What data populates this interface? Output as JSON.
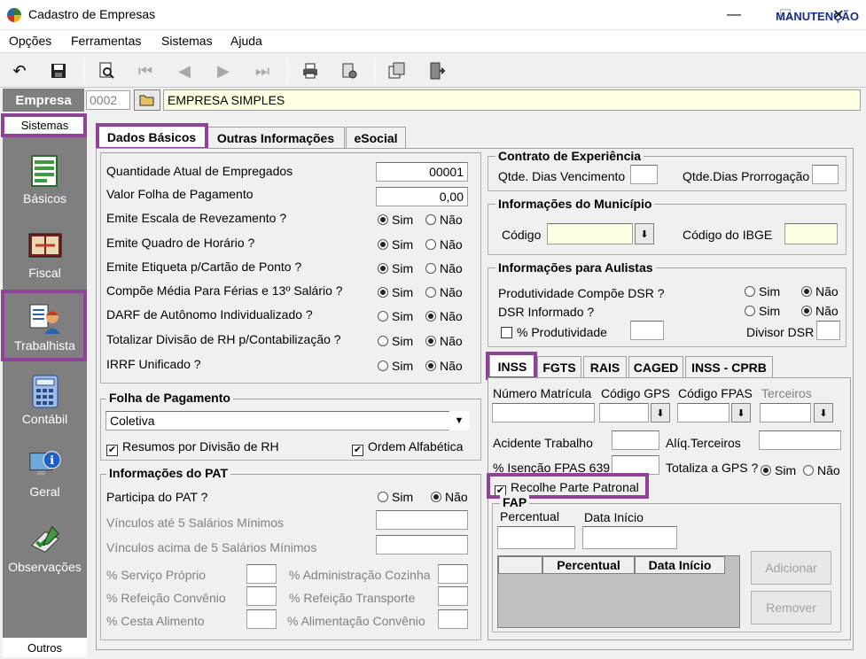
{
  "window": {
    "title": "Cadastro de Empresas",
    "minimize": "—",
    "maximize": "☐",
    "close": "✕"
  },
  "menu": [
    "Opções",
    "Ferramentas",
    "Sistemas",
    "Ajuda"
  ],
  "toolbar": {
    "mode_label": "MANUTENÇÃO"
  },
  "empresa": {
    "label": "Empresa",
    "code": "0002",
    "name": "EMPRESA SIMPLES"
  },
  "sidebar": {
    "header": "Sistemas",
    "footer": "Outros",
    "items": [
      "Básicos",
      "Fiscal",
      "Trabalhista",
      "Contábil",
      "Geral",
      "Observações"
    ]
  },
  "tabs": [
    "Dados Básicos",
    "Outras Informações",
    "eSocial"
  ],
  "dados": {
    "qtd_empregados_label": "Quantidade Atual de Empregados",
    "qtd_empregados": "00001",
    "valor_folha_label": "Valor Folha de Pagamento",
    "valor_folha": "0,00",
    "sim": "Sim",
    "nao": "Não",
    "questions": [
      "Emite Escala de Revezamento ?",
      "Emite Quadro de Horário ?",
      "Emite Etiqueta p/Cartão de Ponto ?",
      "Compõe Média Para Férias e 13º Salário ?",
      "DARF de Autônomo Individualizado ?",
      "Totalizar Divisão de RH p/Contabilização ?",
      "IRRF Unificado ?"
    ]
  },
  "folha": {
    "title": "Folha de Pagamento",
    "tipo": "Coletiva",
    "resumos": "Resumos por Divisão de RH",
    "ordem": "Ordem Alfabética"
  },
  "pat": {
    "title": "Informações do PAT",
    "participa": "Participa do PAT ?",
    "vinc5": "Vínculos até 5 Salários Mínimos",
    "vinc5plus": "Vínculos acima de 5 Salários Mínimos",
    "servico": "% Serviço Próprio",
    "admin": "% Administração Cozinha",
    "refconv": "% Refeição Convênio",
    "reftransp": "% Refeição Transporte",
    "cesta": "% Cesta Alimento",
    "alimconv": "% Alimentação Convênio"
  },
  "contrato": {
    "title": "Contrato de Experiência",
    "venc": "Qtde. Dias Vencimento",
    "prorr": "Qtde.Dias Prorrogação"
  },
  "municipio": {
    "title": "Informações do Município",
    "codigo": "Código",
    "ibge": "Código do IBGE"
  },
  "aulistas": {
    "title": "Informações para Aulistas",
    "prod_dsr": "Produtividade Compõe DSR ?",
    "dsr_inf": "DSR Informado ?",
    "perc_prod": "% Produtividade",
    "divisor": "Divisor DSR"
  },
  "subtabs": [
    "INSS",
    "FGTS",
    "RAIS",
    "CAGED",
    "INSS - CPRB"
  ],
  "inss": {
    "matricula": "Número Matrícula",
    "gps": "Código GPS",
    "fpas": "Código FPAS",
    "terceiros": "Terceiros",
    "acidente": "Acidente Trabalho",
    "aliq": "Alíq.Terceiros",
    "isencao": "% Isenção FPAS 639",
    "totaliza": "Totaliza a GPS ?",
    "recolhe": "Recolhe Parte Patronal",
    "fap": "FAP",
    "percentual": "Percentual",
    "data_inicio": "Data Início",
    "grid_cols": [
      "Percentual",
      "Data Início"
    ],
    "adicionar": "Adicionar",
    "remover": "Remover"
  }
}
